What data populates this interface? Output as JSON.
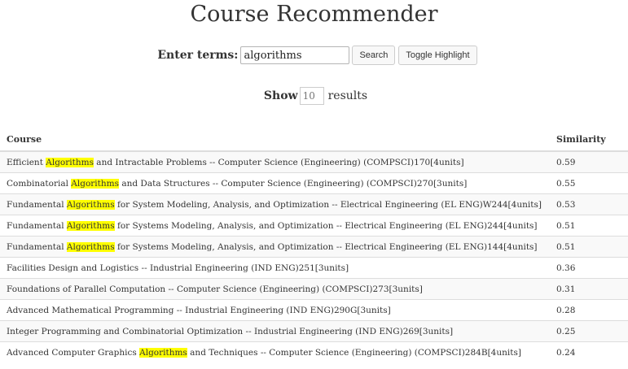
{
  "header": {
    "title": "Course Recommender"
  },
  "search": {
    "label": "Enter terms:",
    "value": "algorithms",
    "search_button": "Search",
    "toggle_button": "Toggle Highlight"
  },
  "show": {
    "label": "Show",
    "placeholder": "10",
    "suffix": "results"
  },
  "table": {
    "columns": [
      "Course",
      "Similarity"
    ],
    "rows": [
      {
        "pre": "Efficient ",
        "hl": "Algorithms",
        "post": " and Intractable Problems -- Computer Science (Engineering) (COMPSCI)170[4units]",
        "similarity": "0.59"
      },
      {
        "pre": "Combinatorial ",
        "hl": "Algorithms",
        "post": " and Data Structures -- Computer Science (Engineering) (COMPSCI)270[3units]",
        "similarity": "0.55"
      },
      {
        "pre": "Fundamental ",
        "hl": "Algorithms",
        "post": " for System Modeling, Analysis, and Optimization -- Electrical Engineering (EL ENG)W244[4units]",
        "similarity": "0.53"
      },
      {
        "pre": "Fundamental ",
        "hl": "Algorithms",
        "post": " for Systems Modeling, Analysis, and Optimization -- Electrical Engineering (EL ENG)244[4units]",
        "similarity": "0.51"
      },
      {
        "pre": "Fundamental ",
        "hl": "Algorithms",
        "post": " for Systems Modeling, Analysis, and Optimization -- Electrical Engineering (EL ENG)144[4units]",
        "similarity": "0.51"
      },
      {
        "pre": "Facilities Design and Logistics -- Industrial Engineering (IND ENG)251[3units]",
        "hl": "",
        "post": "",
        "similarity": "0.36"
      },
      {
        "pre": "Foundations of Parallel Computation -- Computer Science (Engineering) (COMPSCI)273[3units]",
        "hl": "",
        "post": "",
        "similarity": "0.31"
      },
      {
        "pre": "Advanced Mathematical Programming -- Industrial Engineering (IND ENG)290G[3units]",
        "hl": "",
        "post": "",
        "similarity": "0.28"
      },
      {
        "pre": "Integer Programming and Combinatorial Optimization -- Industrial Engineering (IND ENG)269[3units]",
        "hl": "",
        "post": "",
        "similarity": "0.25"
      },
      {
        "pre": "Advanced Computer Graphics ",
        "hl": "Algorithms",
        "post": " and Techniques -- Computer Science (Engineering) (COMPSCI)284B[4units]",
        "similarity": "0.24"
      }
    ]
  },
  "colors": {
    "highlight": "#ffff00",
    "stripe": "#f9f9f9",
    "border": "#dddddd"
  }
}
